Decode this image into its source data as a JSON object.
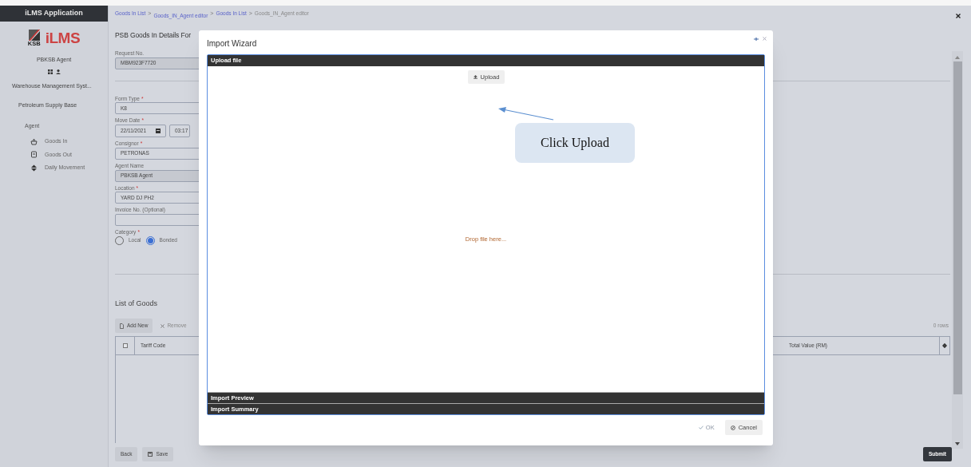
{
  "sidebar": {
    "title": "iLMS Application",
    "logo": {
      "mark": "KSB",
      "name": "iLMS"
    },
    "user": "PBKSB Agent",
    "system": "Warehouse Management Syst...",
    "base": "Petroleum Supply Base",
    "section": "Agent",
    "items": [
      {
        "label": "Goods In",
        "kind": "basket"
      },
      {
        "label": "Goods Out",
        "kind": "box"
      },
      {
        "label": "Daily Movement",
        "kind": "updown"
      }
    ]
  },
  "breadcrumb": [
    {
      "label": "Goods In List",
      "link": true
    },
    {
      "separator": ">",
      "label": "Goods_IN_Agent editor",
      "link": true
    },
    {
      "separator": ">",
      "label": "Goods In List",
      "link": true
    },
    {
      "separator": ">",
      "label": "Goods_IN_Agent editor",
      "link": false
    }
  ],
  "form": {
    "title": "PSB Goods In Details For",
    "fields": [
      {
        "kind": "text",
        "label": "Request No.",
        "value": "MBM923F7720",
        "readonly": true
      },
      {
        "kind": "text",
        "label": "Form Type",
        "required_mark": "*",
        "value": "K8",
        "readonly": false
      },
      {
        "kind": "date",
        "label": "Move Date",
        "required_mark": "*",
        "value": "22/11/2021",
        "time": "03:17",
        "readonly": false
      },
      {
        "kind": "text",
        "label": "Consignor",
        "required_mark": "*",
        "value": "PETRONAS",
        "readonly": false
      },
      {
        "kind": "text",
        "label": "Agent Name",
        "value": "PBKSB Agent",
        "readonly": true
      },
      {
        "kind": "text",
        "label": "Location",
        "required_mark": "*",
        "value": "YARD DJ PH2",
        "readonly": false
      },
      {
        "kind": "text",
        "label": "Invoice No. (Optional)",
        "readonly": false
      },
      {
        "kind": "radio",
        "label": "Category",
        "required_mark": "*",
        "options": [
          {
            "label": "Local",
            "selected": false
          },
          {
            "label": "Bonded",
            "selected": true
          }
        ]
      }
    ]
  },
  "goods": {
    "title": "List of Goods",
    "add": "Add New",
    "remove": "Remove",
    "row_count": "0 rows",
    "select_all_checked": false,
    "columns": [
      "Tariff Code",
      "Total Value (RM)"
    ]
  },
  "footer": {
    "back": "Back",
    "save": "Save",
    "submit": "Submit"
  },
  "dialog": {
    "title": "Import Wizard",
    "sections": [
      {
        "title": "Upload file",
        "expanded": true
      },
      {
        "title": "Import Preview",
        "expanded": false
      },
      {
        "title": "Import Summary",
        "expanded": false
      }
    ],
    "upload": "Upload",
    "drop_hint": "Drop file here...",
    "ok": {
      "label": "OK",
      "disabled": true
    },
    "cancel": "Cancel"
  },
  "callout": "Click Upload"
}
